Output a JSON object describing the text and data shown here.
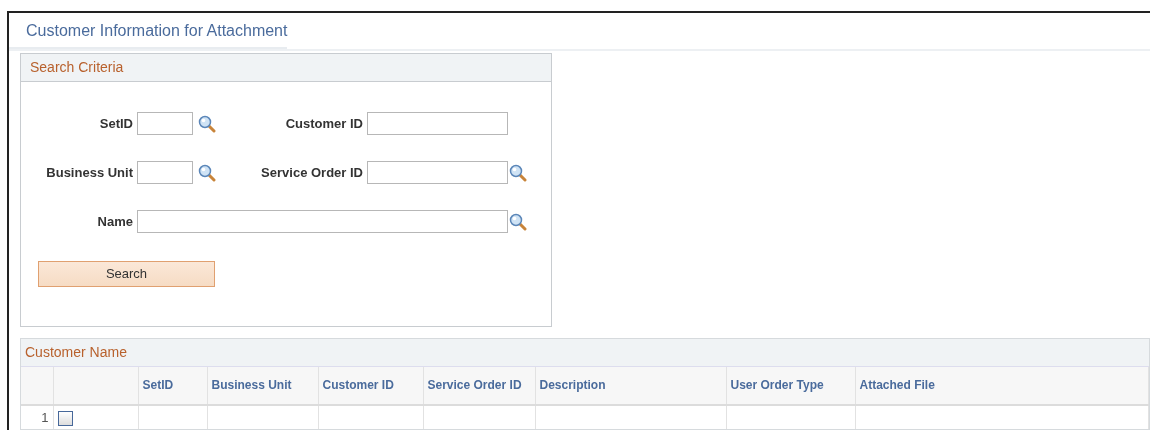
{
  "page": {
    "title": "Customer Information for Attachment"
  },
  "search_criteria": {
    "title": "Search Criteria",
    "rows": [
      [
        {
          "label": "SetID",
          "kind": "lookup"
        },
        {
          "label": "Customer ID",
          "kind": "text"
        }
      ],
      [
        {
          "label": "Business Unit",
          "kind": "lookup"
        },
        {
          "label": "Service Order ID",
          "kind": "lookup"
        }
      ],
      [
        {
          "label": "Name",
          "kind": "lookup"
        }
      ]
    ],
    "button": "Search"
  },
  "grid": {
    "title": "Customer Name",
    "columns": [
      "SetID",
      "Business Unit",
      "Customer ID",
      "Service Order ID",
      "Description",
      "User Order Type",
      "Attached File"
    ],
    "rows": [
      {
        "number": "1",
        "checked": false
      }
    ]
  }
}
